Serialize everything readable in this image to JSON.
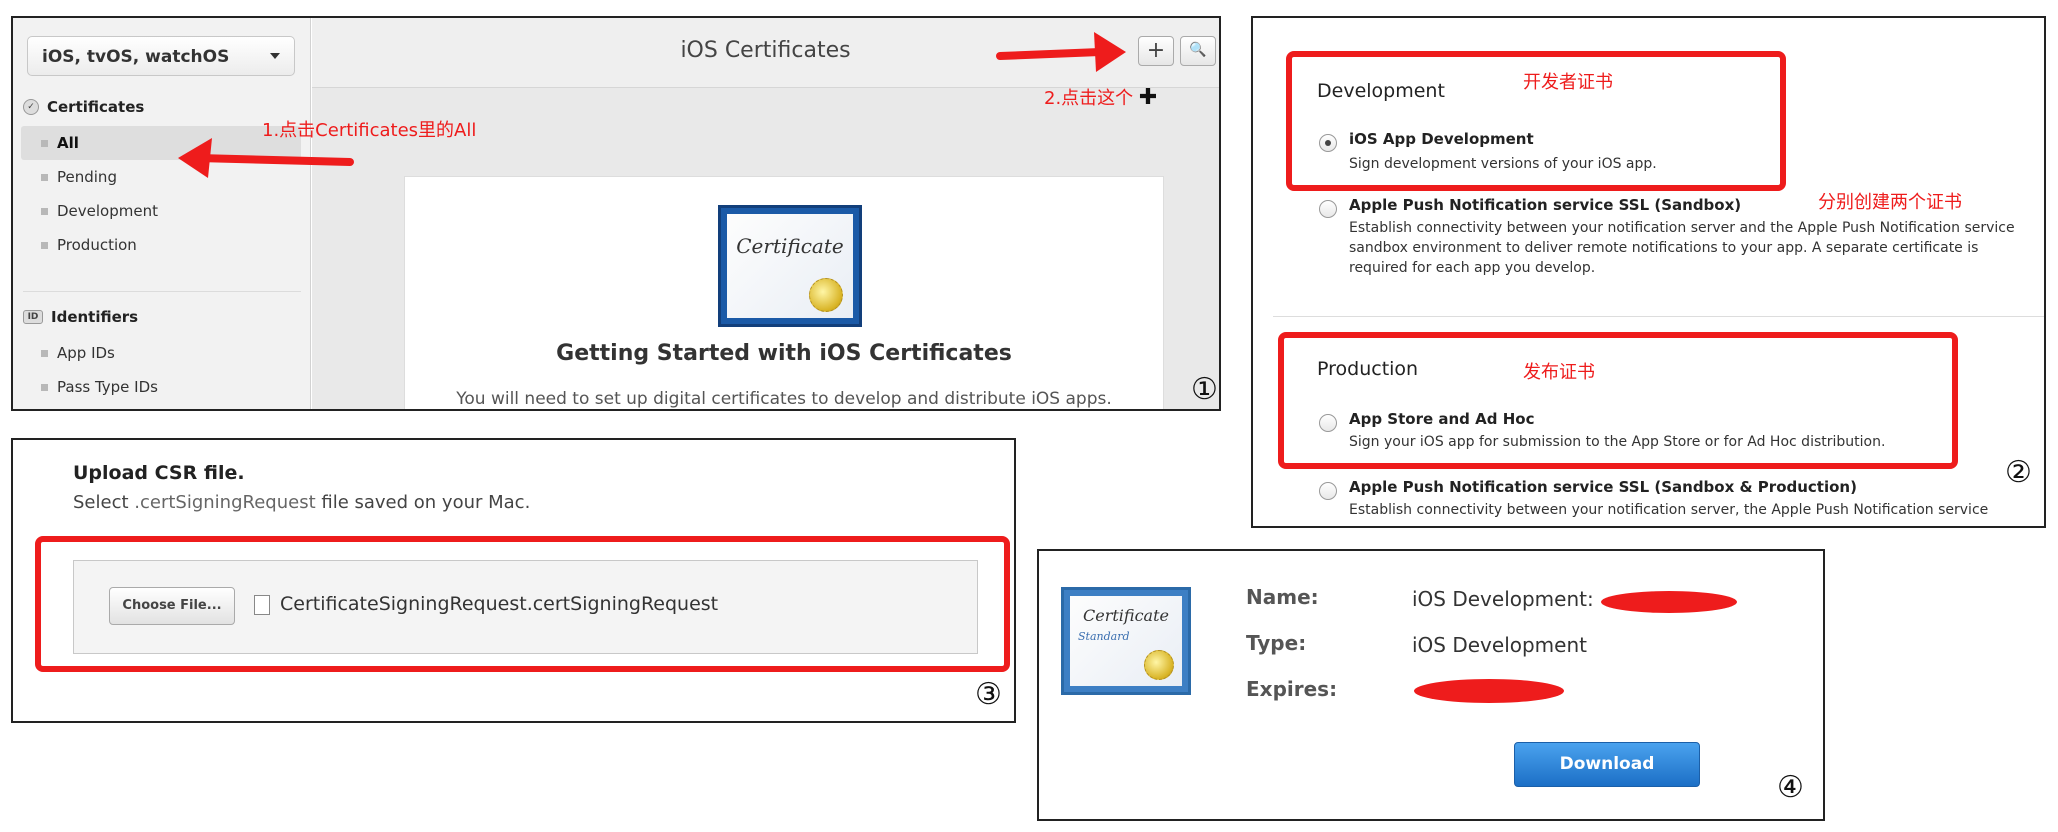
{
  "panel1": {
    "platform_select": "iOS, tvOS, watchOS",
    "sections": [
      {
        "title": "Certificates",
        "items": [
          "All",
          "Pending",
          "Development",
          "Production"
        ]
      },
      {
        "title": "Identifiers",
        "items": [
          "App IDs",
          "Pass Type IDs"
        ]
      }
    ],
    "identifiers_badge": "ID",
    "header_title": "iOS Certificates",
    "add_glyph": "+",
    "search_glyph": "🔍",
    "cert_image_text": "Certificate",
    "card_title": "Getting Started with iOS Certificates",
    "card_text": "You will need to set up digital certificates to develop and distribute iOS apps.",
    "annotation_1": "1.点击Certificates里的All",
    "annotation_2": "2.点击这个",
    "annotation_2_plus": "✚",
    "step": "①"
  },
  "panel2": {
    "development_heading": "Development",
    "development_note": "开发者证书",
    "both_note": "分别创建两个证书",
    "production_heading": "Production",
    "production_note": "发布证书",
    "options": [
      {
        "title": "iOS App Development",
        "desc": "Sign development versions of your iOS app.",
        "selected": true
      },
      {
        "title": "Apple Push Notification service SSL (Sandbox)",
        "desc": "Establish connectivity between your notification server and the Apple Push Notification service sandbox environment to deliver remote notifications to your app. A separate certificate is required for each app you develop.",
        "selected": false
      },
      {
        "title": "App Store and Ad Hoc",
        "desc": "Sign your iOS app for submission to the App Store or for Ad Hoc distribution.",
        "selected": false
      },
      {
        "title": "Apple Push Notification service SSL (Sandbox & Production)",
        "desc": "Establish connectivity between your notification server, the Apple Push Notification service",
        "selected": false
      }
    ],
    "step": "②"
  },
  "panel3": {
    "title": "Upload CSR file.",
    "subtitle_pre": "Select ",
    "subtitle_mono": ".certSigningRequest",
    "subtitle_post": " file saved on your Mac.",
    "choose_button": "Choose File...",
    "file_name": "CertificateSigningRequest.certSigningRequest",
    "step": "③"
  },
  "panel4": {
    "cert_image_text": "Certificate",
    "cert_image_subtext": "Standard",
    "name_label": "Name:",
    "name_value": "iOS Development:",
    "type_label": "Type:",
    "type_value": "iOS Development",
    "expires_label": "Expires:",
    "download_button": "Download",
    "step": "④"
  },
  "colors": {
    "annotation_red": "#ee1c1c",
    "download_blue": "#1c6fc6",
    "certificate_blue": "#1b5aa7"
  }
}
